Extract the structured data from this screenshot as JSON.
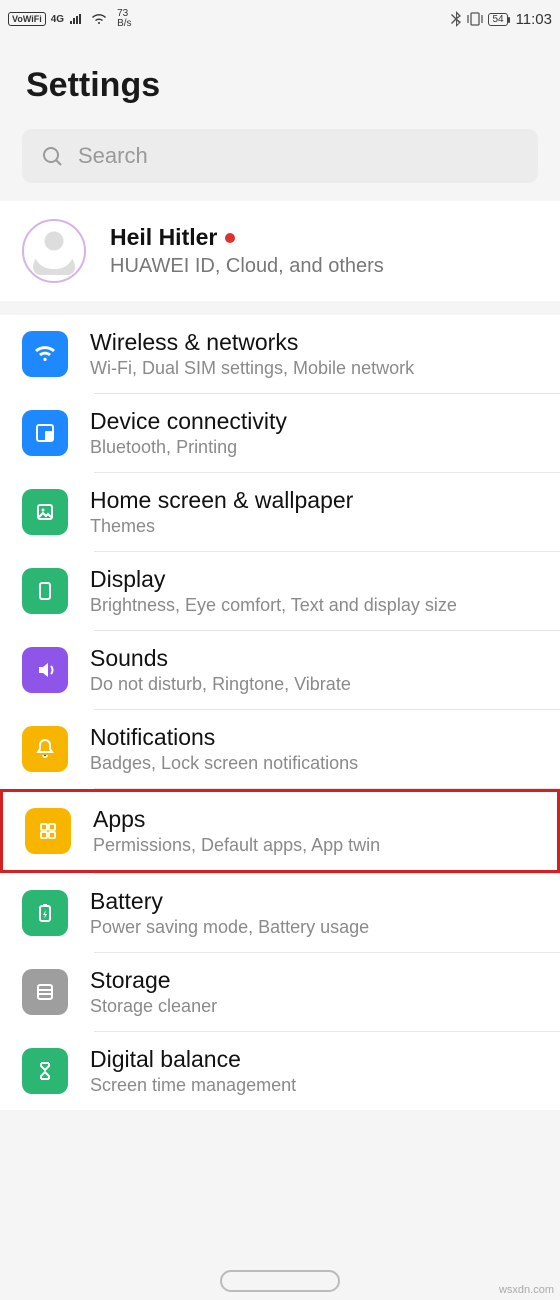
{
  "status": {
    "vowifi": "VoWiFi",
    "net_gen": "4G",
    "speed_val": "73",
    "speed_unit": "B/s",
    "battery": "54",
    "time": "11:03"
  },
  "page_title": "Settings",
  "search": {
    "placeholder": "Search"
  },
  "profile": {
    "name": "Heil Hitler",
    "sub": "HUAWEI ID, Cloud, and others"
  },
  "items": [
    {
      "id": "wireless",
      "title": "Wireless & networks",
      "sub": "Wi-Fi, Dual SIM settings, Mobile network",
      "color": "ic-blue1",
      "icon": "wifi-icon"
    },
    {
      "id": "device",
      "title": "Device connectivity",
      "sub": "Bluetooth, Printing",
      "color": "ic-blue2",
      "icon": "device-icon"
    },
    {
      "id": "home",
      "title": "Home screen & wallpaper",
      "sub": "Themes",
      "color": "ic-green",
      "icon": "wallpaper-icon"
    },
    {
      "id": "display",
      "title": "Display",
      "sub": "Brightness, Eye comfort, Text and display size",
      "color": "ic-green",
      "icon": "display-icon"
    },
    {
      "id": "sounds",
      "title": "Sounds",
      "sub": "Do not disturb, Ringtone, Vibrate",
      "color": "ic-purple",
      "icon": "sound-icon"
    },
    {
      "id": "notif",
      "title": "Notifications",
      "sub": "Badges, Lock screen notifications",
      "color": "ic-yellow",
      "icon": "bell-icon"
    },
    {
      "id": "apps",
      "title": "Apps",
      "sub": "Permissions, Default apps, App twin",
      "color": "ic-yellow",
      "icon": "apps-icon",
      "highlight": true
    },
    {
      "id": "battery",
      "title": "Battery",
      "sub": "Power saving mode, Battery usage",
      "color": "ic-green",
      "icon": "battery-icon"
    },
    {
      "id": "storage",
      "title": "Storage",
      "sub": "Storage cleaner",
      "color": "ic-grey",
      "icon": "storage-icon"
    },
    {
      "id": "digital",
      "title": "Digital balance",
      "sub": "Screen time management",
      "color": "ic-green",
      "icon": "hourglass-icon"
    }
  ],
  "watermark": "wsxdn.com"
}
